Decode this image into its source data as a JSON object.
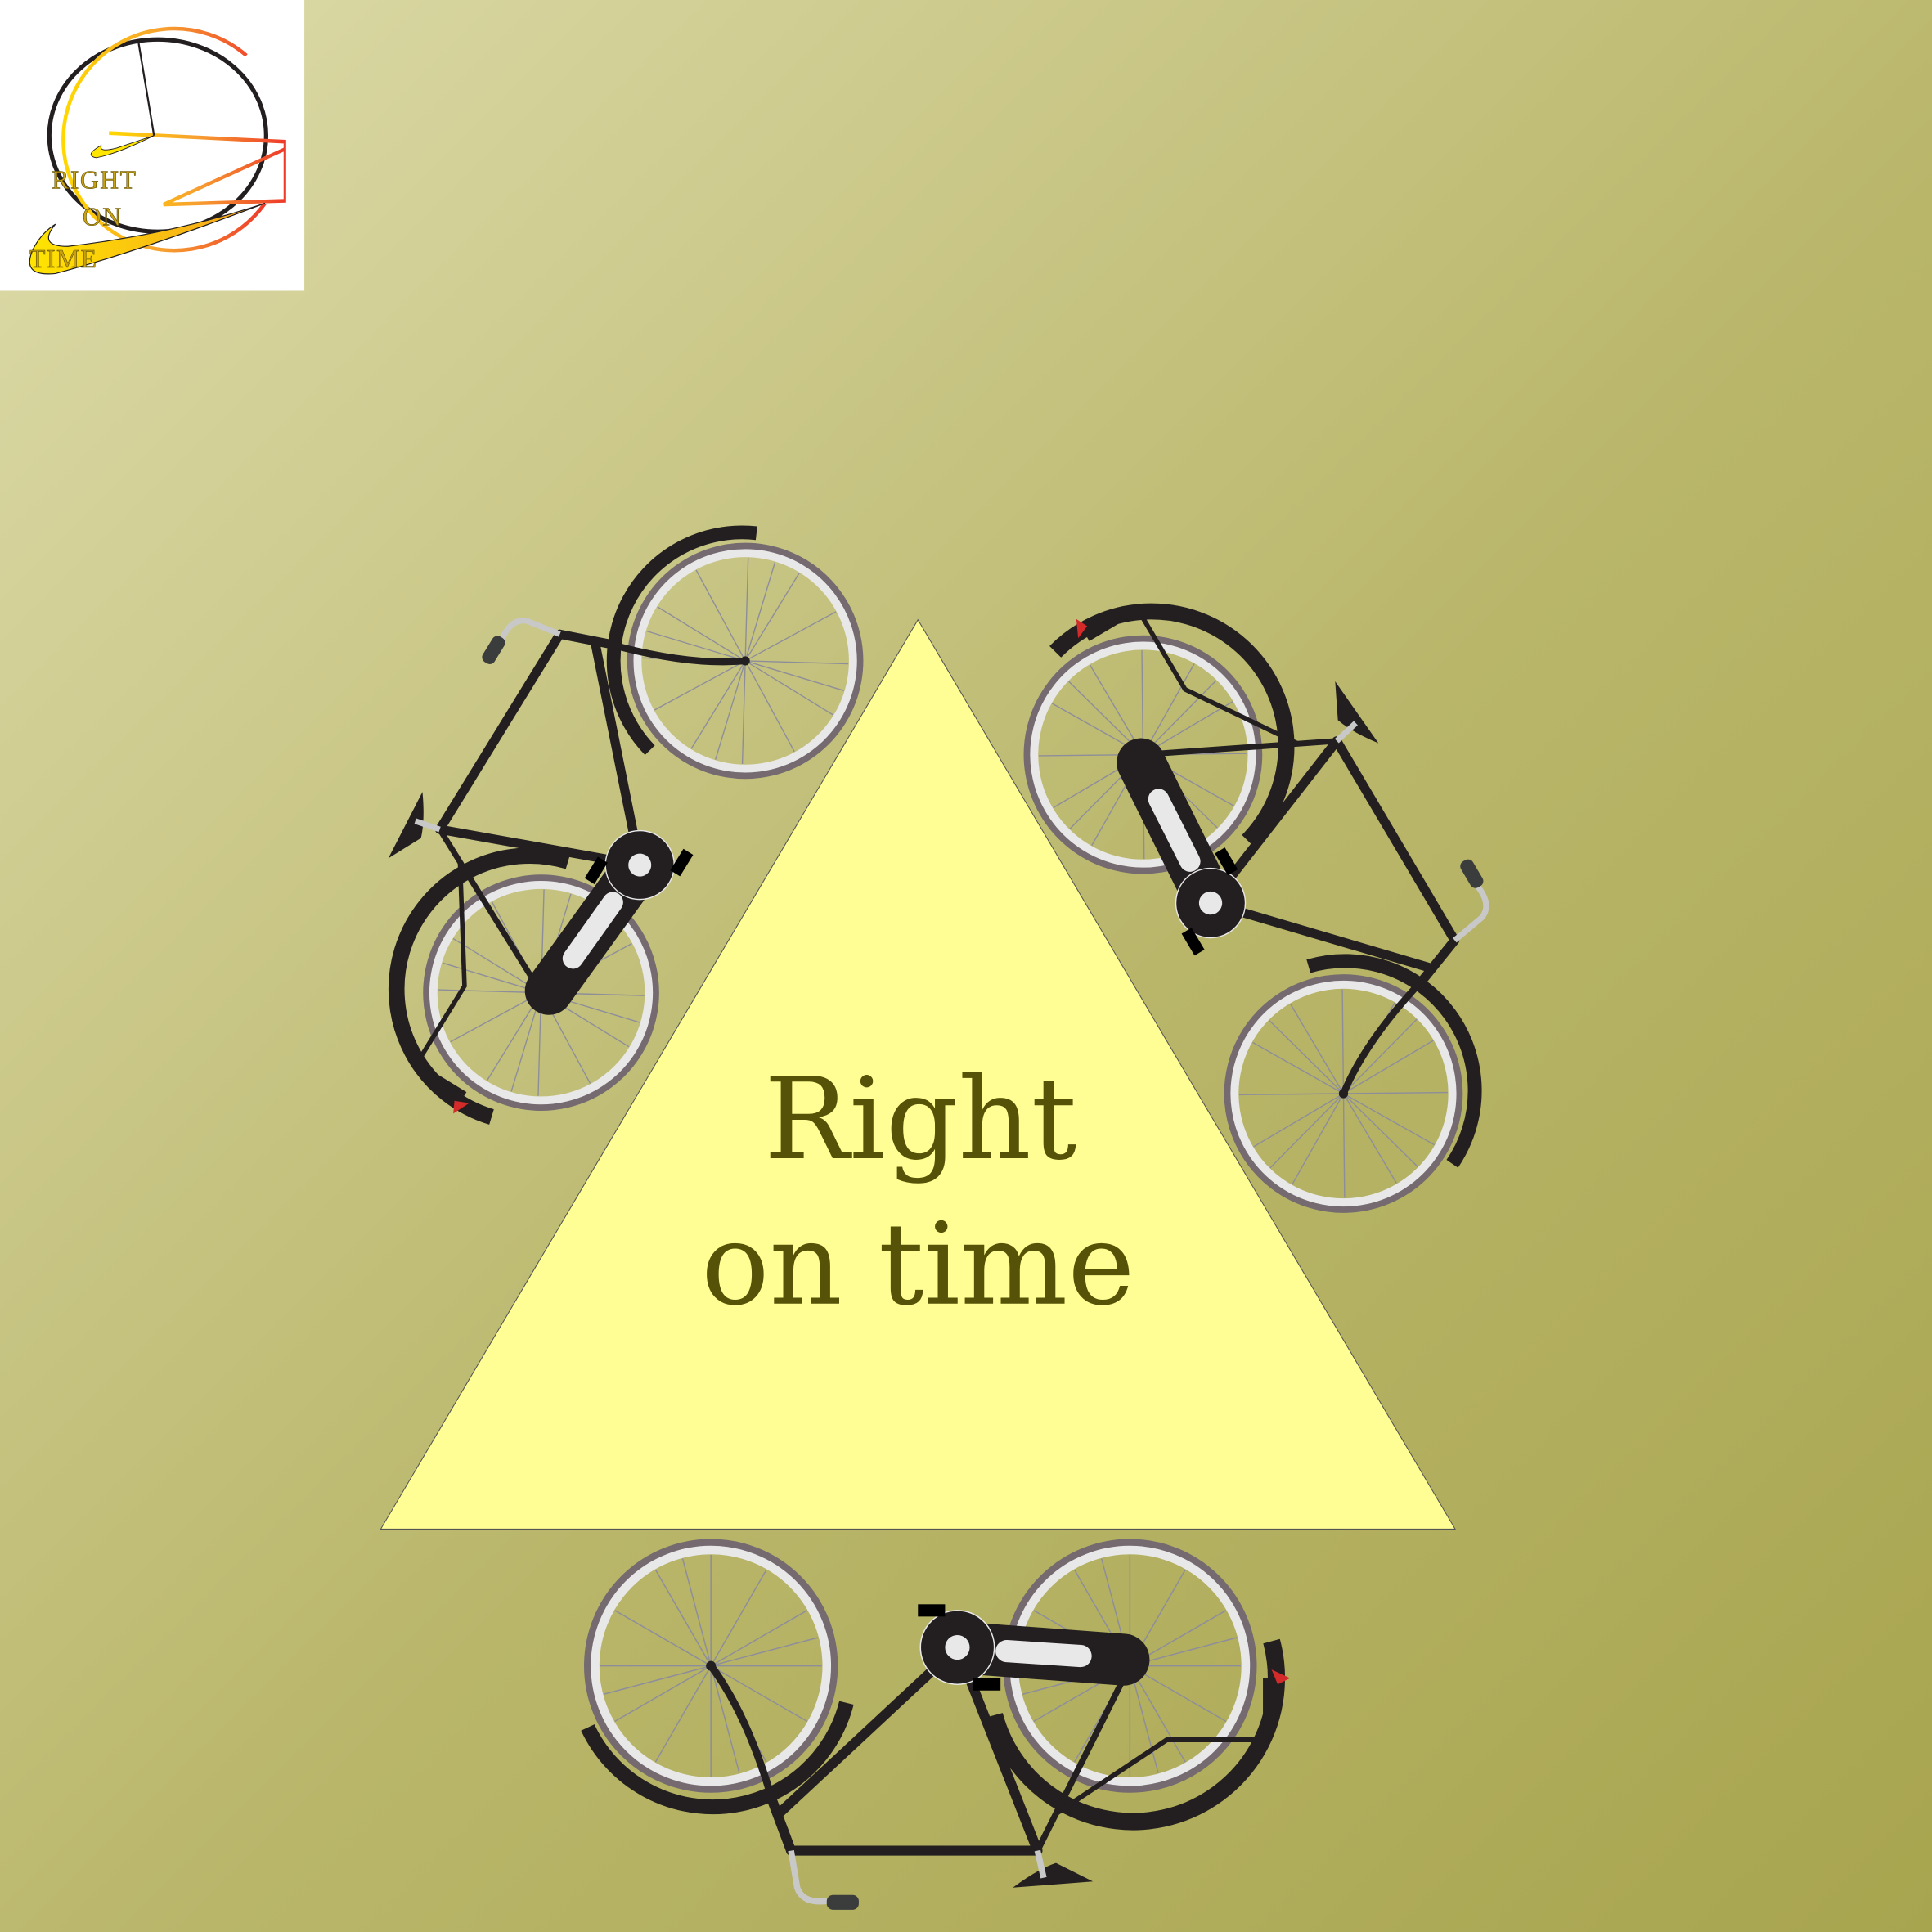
{
  "poster": {
    "title_line1": "Right",
    "title_line2": "on time"
  },
  "logo": {
    "line1": "RIGHT",
    "line2": "ON",
    "line3": "TIME"
  },
  "colors": {
    "background_light": "#dcdaa8",
    "background_dark": "#a9a652",
    "triangle": "#fffe94",
    "title_text": "#565207",
    "bike_frame": "#231f20",
    "tire": "#746a70",
    "rim": "#e8e8e8"
  },
  "icons": [
    "logo-clock-icon",
    "bicycle-icon"
  ]
}
